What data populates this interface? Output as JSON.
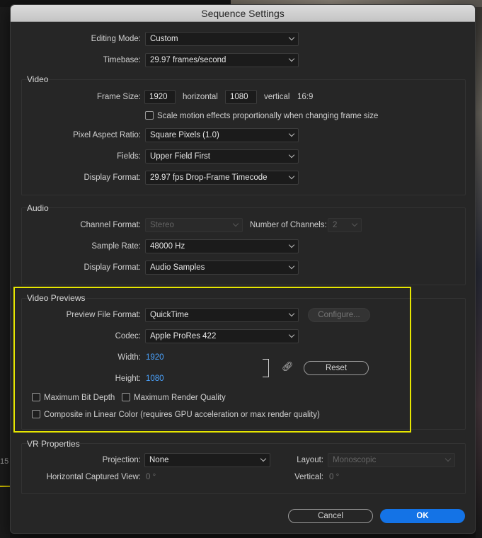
{
  "window": {
    "title": "Sequence Settings"
  },
  "general": {
    "editing_mode_label": "Editing Mode:",
    "editing_mode_value": "Custom",
    "timebase_label": "Timebase:",
    "timebase_value": "29.97  frames/second"
  },
  "video": {
    "title": "Video",
    "frame_size_label": "Frame Size:",
    "frame_width": "1920",
    "horizontal_label": "horizontal",
    "frame_height": "1080",
    "vertical_label": "vertical",
    "aspect": "16:9",
    "scale_motion_label": "Scale motion effects proportionally when changing frame size",
    "pixel_aspect_label": "Pixel Aspect Ratio:",
    "pixel_aspect_value": "Square Pixels (1.0)",
    "fields_label": "Fields:",
    "fields_value": "Upper Field First",
    "display_format_label": "Display Format:",
    "display_format_value": "29.97 fps Drop-Frame Timecode"
  },
  "audio": {
    "title": "Audio",
    "channel_format_label": "Channel Format:",
    "channel_format_value": "Stereo",
    "num_channels_label": "Number of Channels:",
    "num_channels_value": "2",
    "sample_rate_label": "Sample Rate:",
    "sample_rate_value": "48000 Hz",
    "display_format_label": "Display Format:",
    "display_format_value": "Audio Samples"
  },
  "video_previews": {
    "title": "Video Previews",
    "preview_format_label": "Preview File Format:",
    "preview_format_value": "QuickTime",
    "configure_label": "Configure...",
    "codec_label": "Codec:",
    "codec_value": "Apple ProRes 422",
    "width_label": "Width:",
    "width_value": "1920",
    "height_label": "Height:",
    "height_value": "1080",
    "reset_label": "Reset",
    "max_bit_depth_label": "Maximum Bit Depth",
    "max_render_quality_label": "Maximum Render Quality",
    "composite_linear_label": "Composite in Linear Color (requires GPU acceleration or max render quality)"
  },
  "vr": {
    "title": "VR Properties",
    "projection_label": "Projection:",
    "projection_value": "None",
    "layout_label": "Layout:",
    "layout_value": "Monoscopic",
    "h_captured_label": "Horizontal Captured View:",
    "h_captured_value": "0 °",
    "vertical_label": "Vertical:",
    "vertical_value": "0 °"
  },
  "footer": {
    "cancel_label": "Cancel",
    "ok_label": "OK"
  },
  "background": {
    "timeline_number": "15"
  },
  "colors": {
    "accent": "#1473e6",
    "highlight": "#e6e600",
    "value_blue": "#4aa3ff"
  }
}
